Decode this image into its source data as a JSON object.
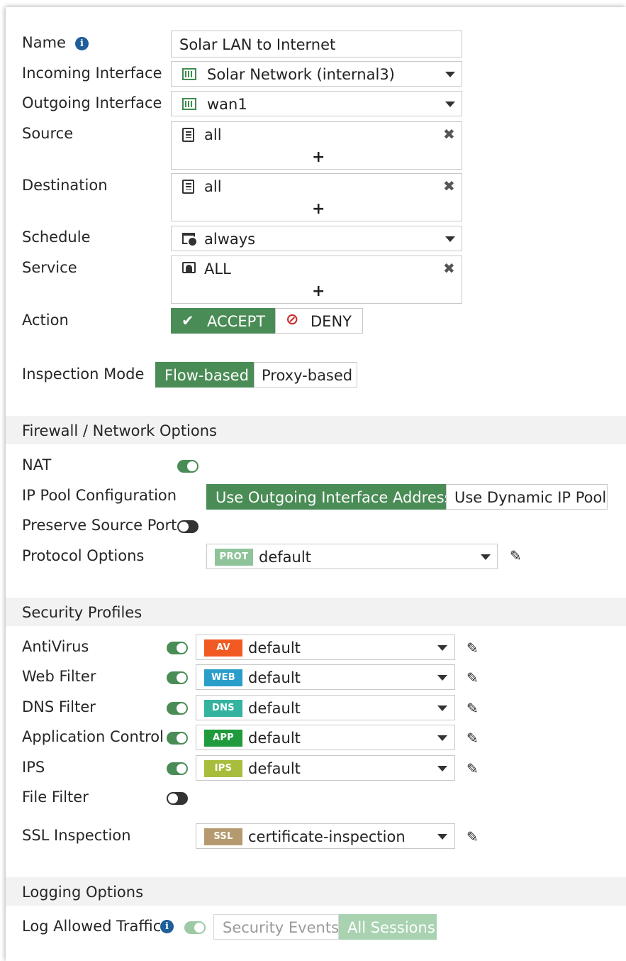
{
  "form": {
    "name_label": "Name",
    "name_value": "Solar LAN to Internet",
    "incoming_label": "Incoming Interface",
    "incoming_value": "Solar Network (internal3)",
    "outgoing_label": "Outgoing Interface",
    "outgoing_value": "wan1",
    "source_label": "Source",
    "source_value": "all",
    "destination_label": "Destination",
    "destination_value": "all",
    "schedule_label": "Schedule",
    "schedule_value": "always",
    "service_label": "Service",
    "service_value": "ALL",
    "add_symbol": "+",
    "remove_symbol": "✖",
    "action_label": "Action",
    "action_accept": "ACCEPT",
    "action_deny": "DENY",
    "action_selected": "ACCEPT",
    "inspection_label": "Inspection Mode",
    "inspection_flow": "Flow-based",
    "inspection_proxy": "Proxy-based",
    "inspection_selected": "Flow-based"
  },
  "firewall": {
    "section_title": "Firewall / Network Options",
    "nat_label": "NAT",
    "nat_enabled": true,
    "ippool_label": "IP Pool Configuration",
    "ippool_outgoing": "Use Outgoing Interface Address",
    "ippool_dynamic": "Use Dynamic IP Pool",
    "ippool_selected": "Use Outgoing Interface Address",
    "preserve_label": "Preserve Source Port",
    "preserve_enabled": false,
    "protocol_label": "Protocol Options",
    "protocol_badge": "PROT",
    "protocol_value": "default"
  },
  "security": {
    "section_title": "Security Profiles",
    "profiles": [
      {
        "label": "AntiVirus",
        "enabled": true,
        "badge": "AV",
        "badge_color": "#f15a22",
        "value": "default"
      },
      {
        "label": "Web Filter",
        "enabled": true,
        "badge": "WEB",
        "badge_color": "#2a9ec9",
        "value": "default"
      },
      {
        "label": "DNS Filter",
        "enabled": true,
        "badge": "DNS",
        "badge_color": "#33b3a0",
        "value": "default"
      },
      {
        "label": "Application Control",
        "enabled": true,
        "badge": "APP",
        "badge_color": "#1f9a3c",
        "value": "default"
      },
      {
        "label": "IPS",
        "enabled": true,
        "badge": "IPS",
        "badge_color": "#a9bd3c",
        "value": "default"
      }
    ],
    "filefilter_label": "File Filter",
    "filefilter_enabled": false,
    "ssl_label": "SSL Inspection",
    "ssl_badge": "SSL",
    "ssl_badge_color": "#b59a6f",
    "ssl_value": "certificate-inspection"
  },
  "logging": {
    "section_title": "Logging Options",
    "log_label": "Log Allowed Traffic",
    "log_enabled": true,
    "log_security_events": "Security Events",
    "log_all_sessions": "All Sessions",
    "log_selected": "All Sessions"
  },
  "colors": {
    "accent_green": "#4a8c55",
    "deny_red": "#c9302c",
    "prot_badge": "#8fc49a",
    "info_blue": "#1e5e9a"
  },
  "icons": {
    "info": "i",
    "check": "✔",
    "deny": "⊘",
    "pencil": "✎"
  }
}
